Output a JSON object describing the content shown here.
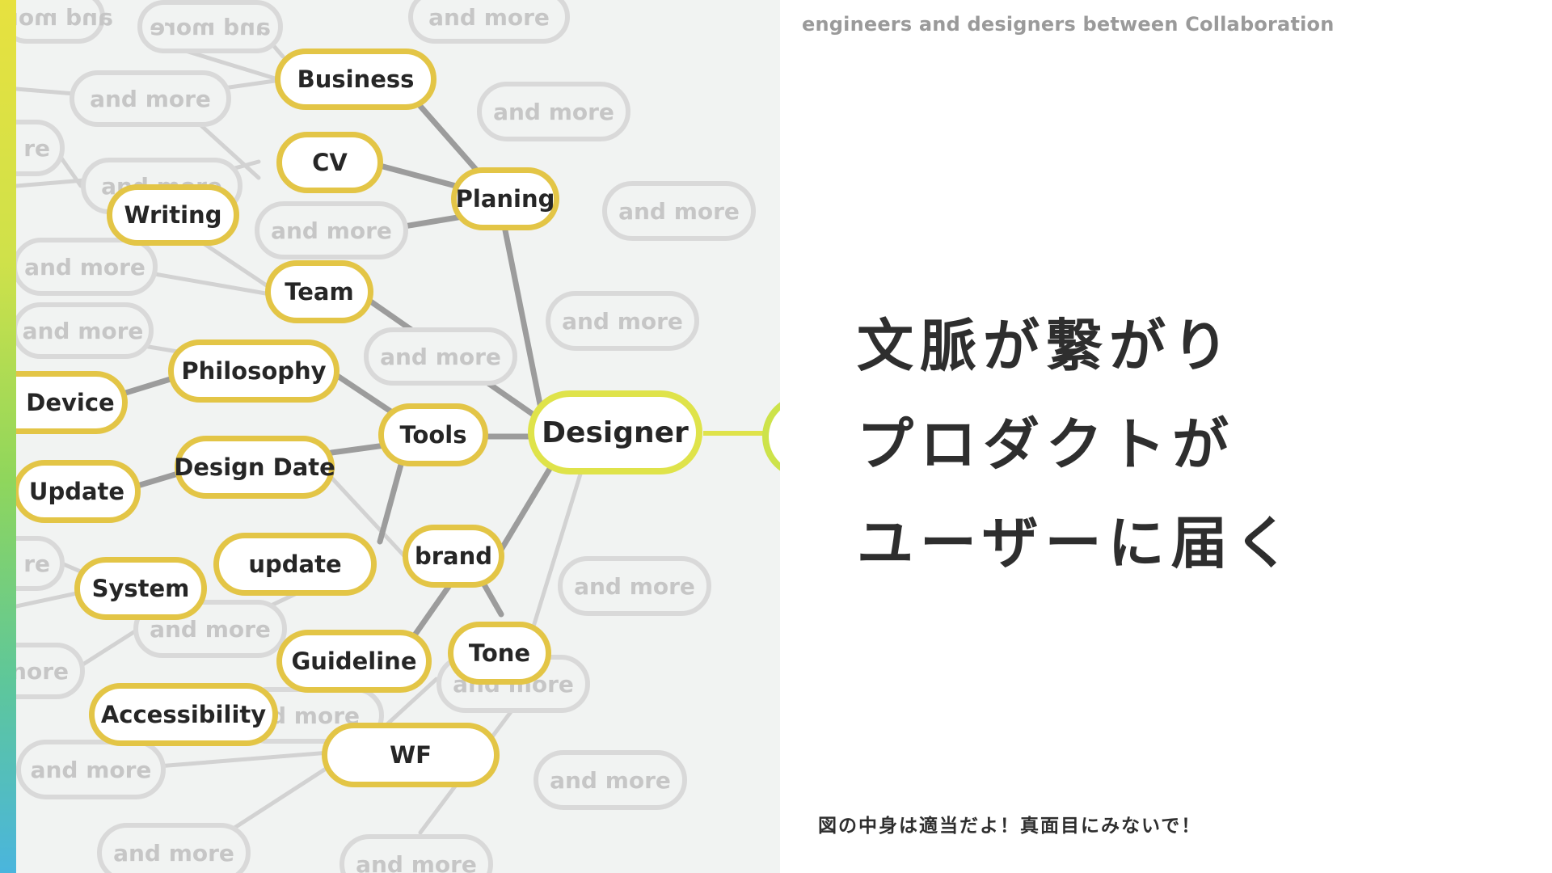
{
  "subtitle": "engineers and designers between Collaboration",
  "headline": [
    "文脈が繋がり",
    "プロダクトが",
    "ユーザーに届く"
  ],
  "footnote": "図の中身は適当だよ！真面目にみないで！",
  "colors": {
    "accent_gradient": [
      "#e7e13f",
      "#8fd65c",
      "#4ab5dd"
    ],
    "node_border": "#e3c546",
    "hub_border": "#dfe34a",
    "ghost_border": "#d9d9d9",
    "edge_dark": "#9c9c9c",
    "edge_light": "#cfcfcf",
    "panel_bg": "#f1f3f2"
  },
  "mindmap": {
    "hub": "Designer",
    "main_nodes": [
      "Business",
      "CV",
      "Planing",
      "Writing",
      "Team",
      "Philosophy",
      "Device",
      "Tools",
      "Design Date",
      "Update",
      "brand",
      "update",
      "System",
      "Guideline",
      "Tone",
      "Accessibility",
      "WF"
    ],
    "ghost_label": "and more",
    "ghost_partial": [
      "re",
      "re",
      "nore"
    ]
  }
}
